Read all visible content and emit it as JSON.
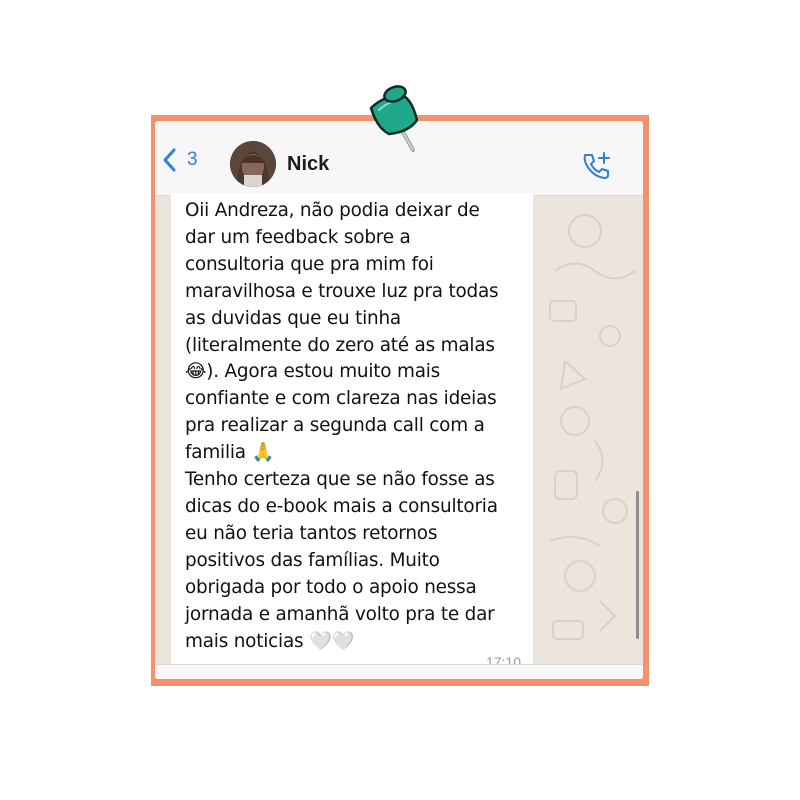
{
  "header": {
    "back_count": "3",
    "contact_name": "Nick"
  },
  "message": {
    "text": "Oii Andreza, não podia deixar de\ndar um feedback sobre a\nconsultoria que pra mim foi\nmaravilhosa e trouxe luz pra todas\nas duvidas que eu tinha\n(literalmente do zero até as malas\n😂). Agora estou muito mais\nconfiante e com clareza nas ideias\npra realizar a segunda call com a\nfamilia 🙏\nTenho certeza que se não fosse as\ndicas do e-book mais a consultoria\neu não teria tantos retornos\npositivos das famílias. Muito\nobrigada por todo o apoio nessa\njornada e amanhã volto pra te dar\nmais noticias 🤍🤍",
    "time": "17:10"
  },
  "colors": {
    "frame": "#f6926b",
    "accent": "#2f80d6",
    "pin": "#1fa98a",
    "chat_background": "#ece5dd",
    "bubble": "#ffffff"
  },
  "icons": {
    "back": "chevron-left-icon",
    "call": "phone-plus-icon",
    "pin": "push-pin-icon"
  }
}
